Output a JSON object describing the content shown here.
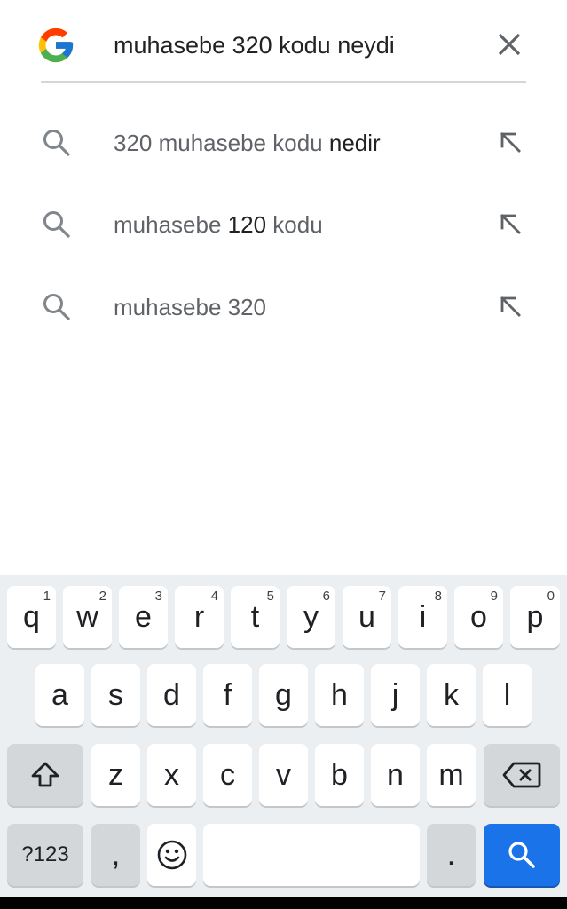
{
  "search": {
    "query": "muhasebe 320 kodu neydi"
  },
  "suggestions": [
    {
      "parts": [
        {
          "text": "320 muhasebe kodu ",
          "bold": false
        },
        {
          "text": "nedir",
          "bold": true
        }
      ]
    },
    {
      "parts": [
        {
          "text": "muhasebe ",
          "bold": false
        },
        {
          "text": "120",
          "bold": true
        },
        {
          "text": " kodu",
          "bold": false
        }
      ]
    },
    {
      "parts": [
        {
          "text": "muhasebe 320",
          "bold": false
        }
      ]
    }
  ],
  "keyboard": {
    "row1": [
      {
        "label": "q",
        "hint": "1"
      },
      {
        "label": "w",
        "hint": "2"
      },
      {
        "label": "e",
        "hint": "3"
      },
      {
        "label": "r",
        "hint": "4"
      },
      {
        "label": "t",
        "hint": "5"
      },
      {
        "label": "y",
        "hint": "6"
      },
      {
        "label": "u",
        "hint": "7"
      },
      {
        "label": "i",
        "hint": "8"
      },
      {
        "label": "o",
        "hint": "9"
      },
      {
        "label": "p",
        "hint": "0"
      }
    ],
    "row2": [
      "a",
      "s",
      "d",
      "f",
      "g",
      "h",
      "j",
      "k",
      "l"
    ],
    "row3": [
      "z",
      "x",
      "c",
      "v",
      "b",
      "n",
      "m"
    ],
    "mode_label": "?123",
    "comma_label": ",",
    "period_label": ".",
    "icons": {
      "shift": "shift-icon",
      "backspace": "backspace-icon",
      "emoji": "emoji-icon",
      "search": "search-icon"
    },
    "colors": {
      "search_key": "#1a73e8",
      "background": "#eceff1"
    }
  }
}
